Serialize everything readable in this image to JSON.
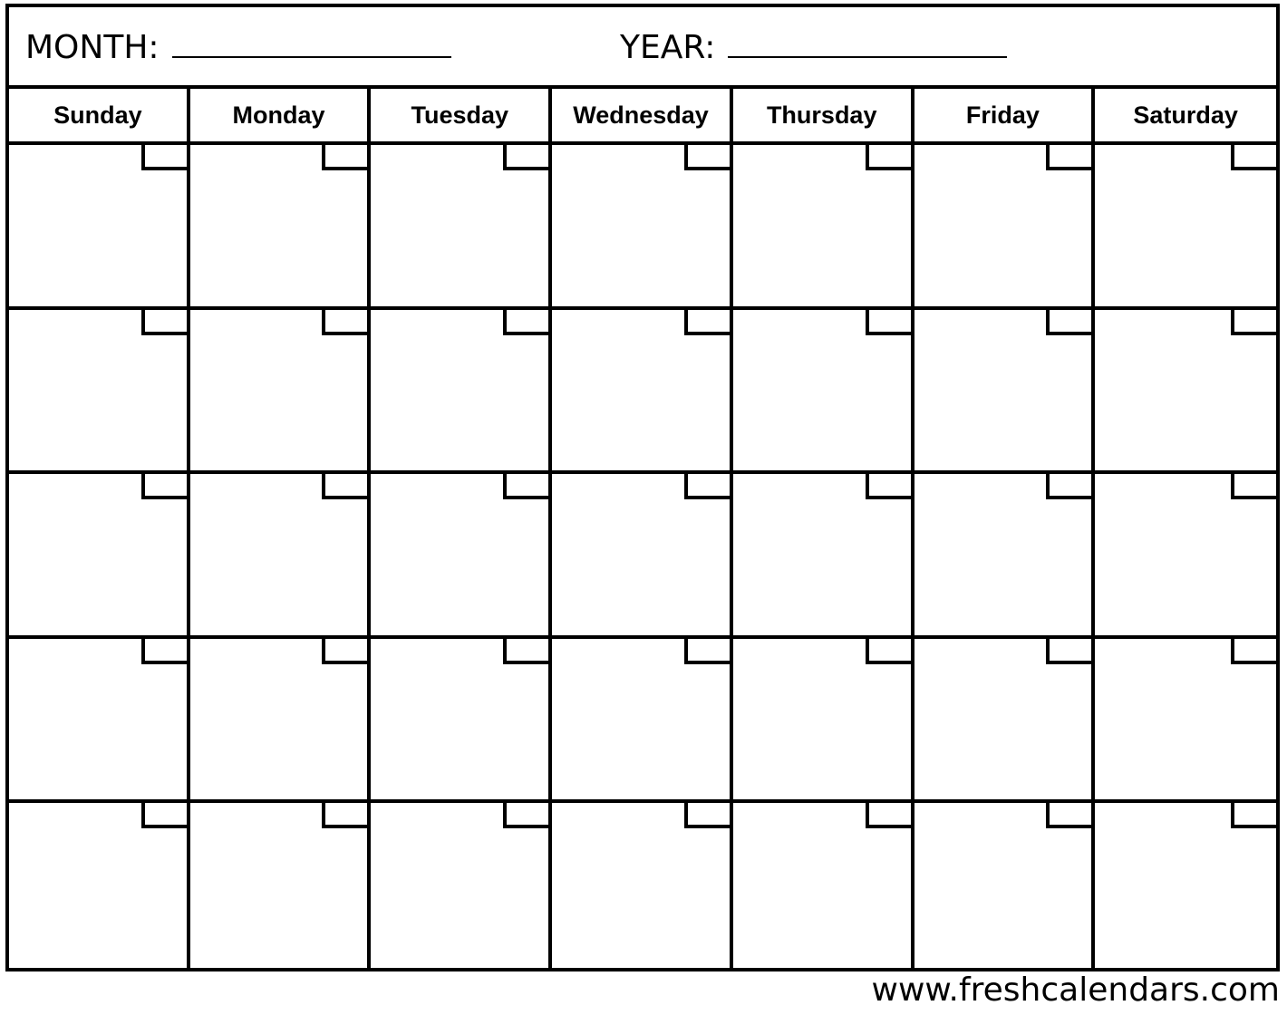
{
  "header": {
    "month_label": "MONTH:",
    "year_label": "YEAR:",
    "month_value": "",
    "year_value": ""
  },
  "weekdays": [
    "Sunday",
    "Monday",
    "Tuesday",
    "Wednesday",
    "Thursday",
    "Friday",
    "Saturday"
  ],
  "weeks": 5,
  "footer": {
    "url": "www.freshcalendars.com"
  }
}
